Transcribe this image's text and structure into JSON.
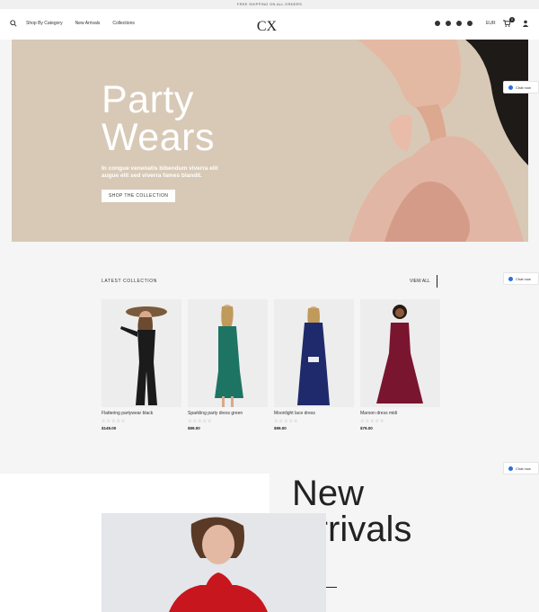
{
  "topbar": {
    "text": "FREE SHIPPING ON ALL ORDERS"
  },
  "header": {
    "nav": [
      "Shop By Category",
      "New Arrivals",
      "Collections"
    ],
    "logo_text": "CX",
    "currency": "EUR",
    "cart_count": "0"
  },
  "hero": {
    "title_line1": "Party",
    "title_line2": "Wears",
    "subtitle": "In congue venenatis bibendum viverra elit augue elit sed viverra fames blandit.",
    "button_label": "SHOP THE COLLECTION"
  },
  "chat_widgets": [
    "Chat now",
    "Chat now",
    "Chat now"
  ],
  "collection": {
    "title": "LATEST COLLECTION",
    "view_all": "VIEW ALL",
    "products": [
      {
        "name": "Flattering partywear black",
        "rating": "☆☆☆☆☆",
        "price": "$149.00",
        "dress_color": "#1b1b1b"
      },
      {
        "name": "Sparkling party dress green",
        "rating": "☆☆☆☆☆",
        "price": "$99.00",
        "dress_color": "#1e7463"
      },
      {
        "name": "Moonlight lace dress",
        "rating": "☆☆☆☆☆",
        "price": "$99.00",
        "dress_color": "#1e2a6b"
      },
      {
        "name": "Maroon dress midi",
        "rating": "☆☆☆☆☆",
        "price": "$79.00",
        "dress_color": "#7a1530"
      }
    ]
  },
  "new_arrivals": {
    "line1": "New",
    "line2": "Arrivals"
  }
}
